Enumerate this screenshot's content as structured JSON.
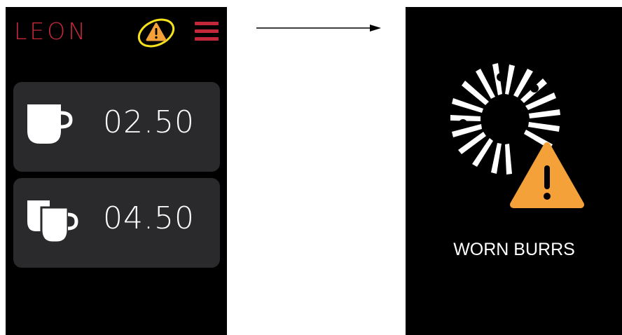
{
  "left_screen": {
    "brand": "LEON",
    "brand_color": "#c2283a",
    "warning_icon": "warning-triangle-icon",
    "warning_color": "#f4a13a",
    "menu_icon": "hamburger-menu-icon",
    "drinks": [
      {
        "icon": "single-cup-icon",
        "price": "02.50"
      },
      {
        "icon": "double-cup-icon",
        "price": "04.50"
      }
    ]
  },
  "right_screen": {
    "icon": "burr-grinder-icon",
    "status": "WORN BURRS"
  }
}
